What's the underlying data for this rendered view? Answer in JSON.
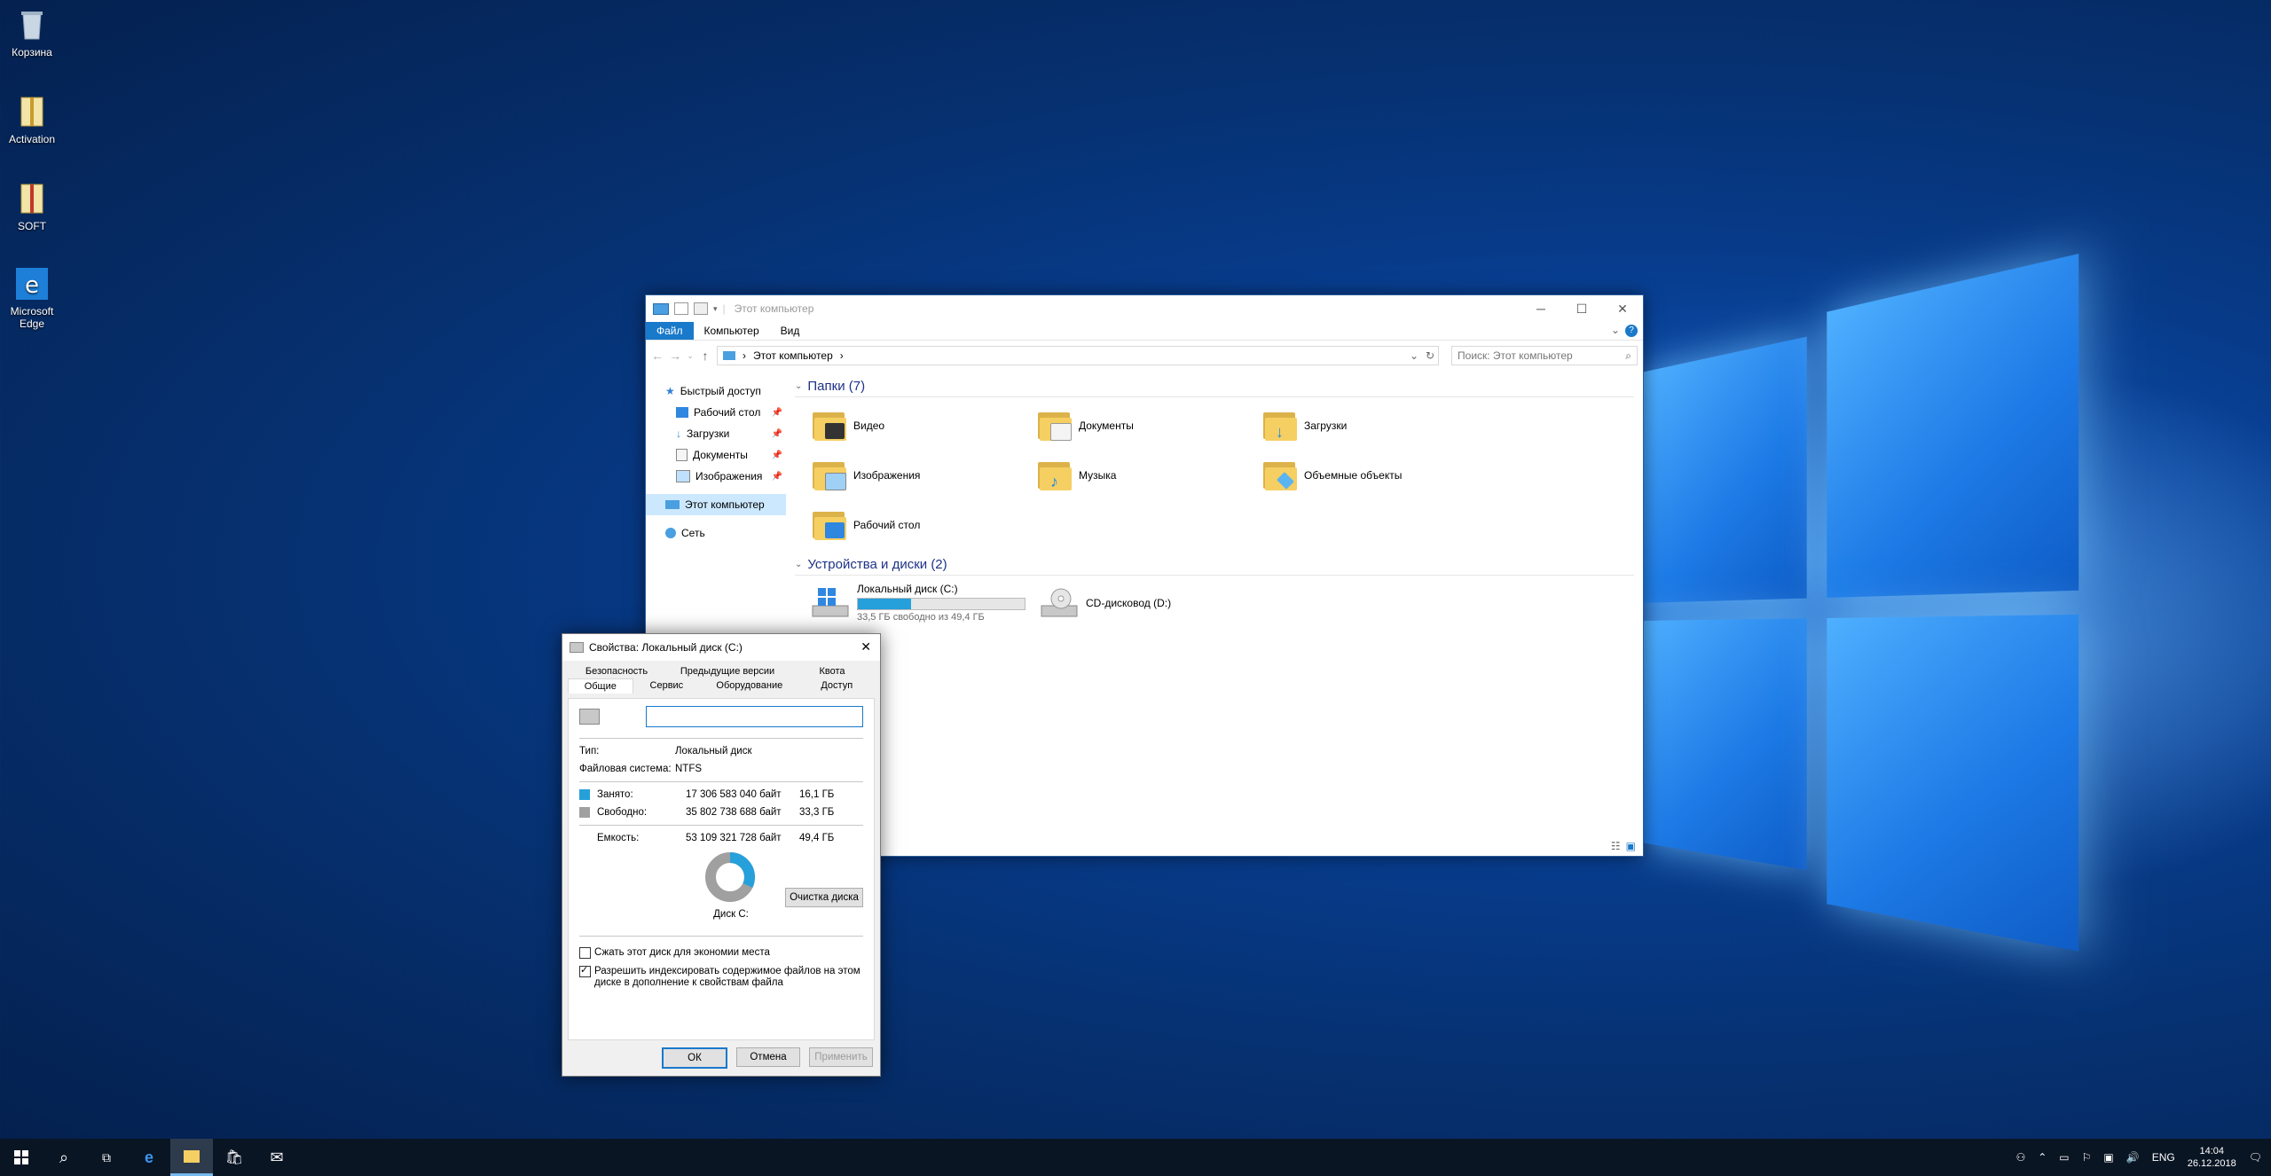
{
  "desktop": {
    "icons": [
      {
        "label": "Корзина"
      },
      {
        "label": "Activation"
      },
      {
        "label": "SOFT"
      },
      {
        "label": "Microsoft Edge"
      }
    ]
  },
  "explorer": {
    "title": "Этот компьютер",
    "ribbon": {
      "file": "Файл",
      "computer": "Компьютер",
      "view": "Вид"
    },
    "address": {
      "separator": "›",
      "crumb": "Этот компьютер",
      "crumb_arrow": "›"
    },
    "search_placeholder": "Поиск: Этот компьютер",
    "sidebar": {
      "quick_access": "Быстрый доступ",
      "quick_items": [
        {
          "label": "Рабочий стол"
        },
        {
          "label": "Загрузки"
        },
        {
          "label": "Документы"
        },
        {
          "label": "Изображения"
        }
      ],
      "this_pc": "Этот компьютер",
      "network": "Сеть"
    },
    "folders_header": "Папки (7)",
    "folders": [
      {
        "label": "Видео"
      },
      {
        "label": "Документы"
      },
      {
        "label": "Загрузки"
      },
      {
        "label": "Изображения"
      },
      {
        "label": "Музыка"
      },
      {
        "label": "Объемные объекты"
      },
      {
        "label": "Рабочий стол"
      }
    ],
    "devices_header": "Устройства и диски (2)",
    "drives": [
      {
        "label": "Локальный диск (C:)",
        "sub": "33,5 ГБ свободно из 49,4 ГБ",
        "used_fraction": 0.32
      },
      {
        "label": "CD-дисковод (D:)"
      }
    ]
  },
  "props": {
    "title": "Свойства: Локальный диск (C:)",
    "tabs_row1": [
      "Безопасность",
      "Предыдущие версии",
      "Квота"
    ],
    "tabs_row2": [
      "Общие",
      "Сервис",
      "Оборудование",
      "Доступ"
    ],
    "name_value": "",
    "type_label": "Тип:",
    "type_value": "Локальный диск",
    "fs_label": "Файловая система:",
    "fs_value": "NTFS",
    "used_label": "Занято:",
    "used_bytes": "17 306 583 040 байт",
    "used_gb": "16,1 ГБ",
    "free_label": "Свободно:",
    "free_bytes": "35 802 738 688 байт",
    "free_gb": "33,3 ГБ",
    "cap_label": "Емкость:",
    "cap_bytes": "53 109 321 728 байт",
    "cap_gb": "49,4 ГБ",
    "disk_label": "Диск C:",
    "cleanup": "Очистка диска",
    "compress": "Сжать этот диск для экономии места",
    "index": "Разрешить индексировать содержимое файлов на этом диске в дополнение к свойствам файла",
    "ok": "ОК",
    "cancel": "Отмена",
    "apply": "Применить",
    "used_color": "#26a0da",
    "free_color": "#a0a0a0"
  },
  "taskbar": {
    "lang": "ENG",
    "time": "14:04",
    "date": "26.12.2018"
  }
}
